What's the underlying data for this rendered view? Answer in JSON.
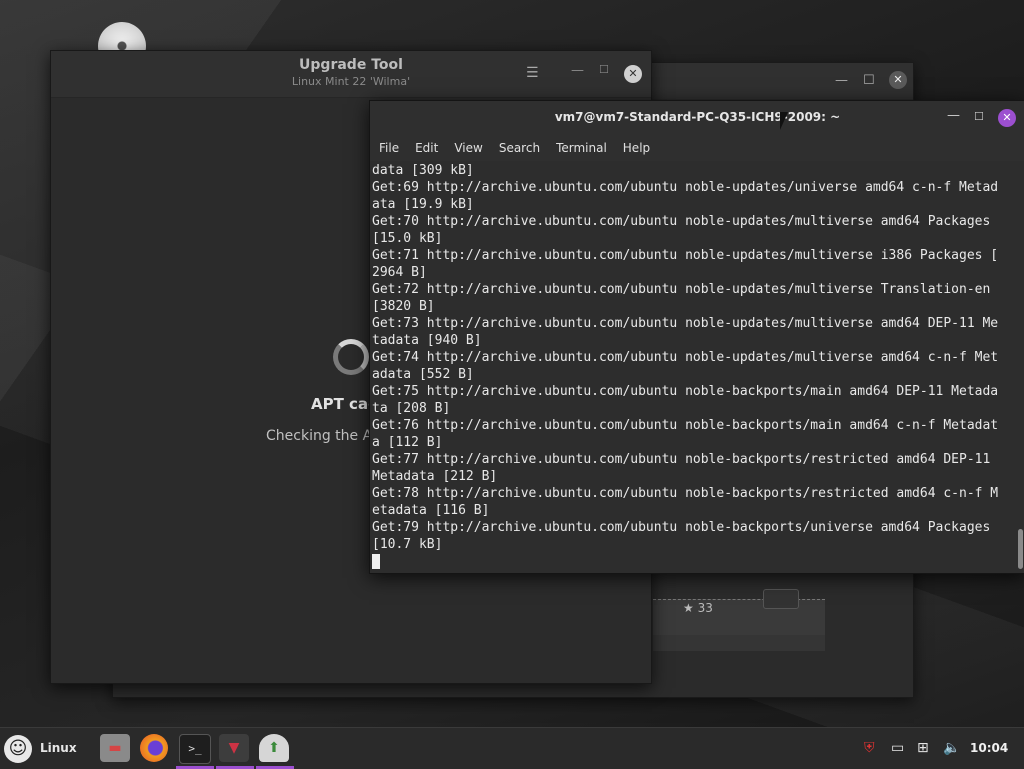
{
  "taskbar": {
    "menu_label": "Linux",
    "clock": "10:04"
  },
  "upgrade_tool": {
    "title": "Upgrade Tool",
    "subtitle": "Linux Mint 22 'Wilma'",
    "status_title": "APT cac",
    "status_subtitle": "Checking the AP"
  },
  "terminal": {
    "title": "vm7@vm7-Standard-PC-Q35-ICH9-2009: ~",
    "menu": [
      "File",
      "Edit",
      "View",
      "Search",
      "Terminal",
      "Help"
    ],
    "lines": [
      "data [309 kB]",
      "Get:69 http://archive.ubuntu.com/ubuntu noble-updates/universe amd64 c-n-f Metad",
      "ata [19.9 kB]",
      "Get:70 http://archive.ubuntu.com/ubuntu noble-updates/multiverse amd64 Packages",
      "[15.0 kB]",
      "Get:71 http://archive.ubuntu.com/ubuntu noble-updates/multiverse i386 Packages [",
      "2964 B]",
      "Get:72 http://archive.ubuntu.com/ubuntu noble-updates/multiverse Translation-en",
      "[3820 B]",
      "Get:73 http://archive.ubuntu.com/ubuntu noble-updates/multiverse amd64 DEP-11 Me",
      "tadata [940 B]",
      "Get:74 http://archive.ubuntu.com/ubuntu noble-updates/multiverse amd64 c-n-f Met",
      "adata [552 B]",
      "Get:75 http://archive.ubuntu.com/ubuntu noble-backports/main amd64 DEP-11 Metada",
      "ta [208 B]",
      "Get:76 http://archive.ubuntu.com/ubuntu noble-backports/main amd64 c-n-f Metadat",
      "a [112 B]",
      "Get:77 http://archive.ubuntu.com/ubuntu noble-backports/restricted amd64 DEP-11",
      "Metadata [212 B]",
      "Get:78 http://archive.ubuntu.com/ubuntu noble-backports/restricted amd64 c-n-f M",
      "etadata [116 B]",
      "Get:79 http://archive.ubuntu.com/ubuntu noble-backports/universe amd64 Packages",
      "[10.7 kB]"
    ]
  },
  "background_window": {
    "star_count": "33"
  },
  "colors": {
    "accent": "#9c4fd0",
    "terminal_bg": "#2d2d2d"
  },
  "icons": [
    "disc-icon",
    "mint-menu-icon",
    "files-icon",
    "firefox-icon",
    "terminal-icon",
    "cinnamon-icon",
    "upgrade-tool-icon",
    "shield-icon",
    "display-icon",
    "network-icon",
    "volume-icon"
  ]
}
